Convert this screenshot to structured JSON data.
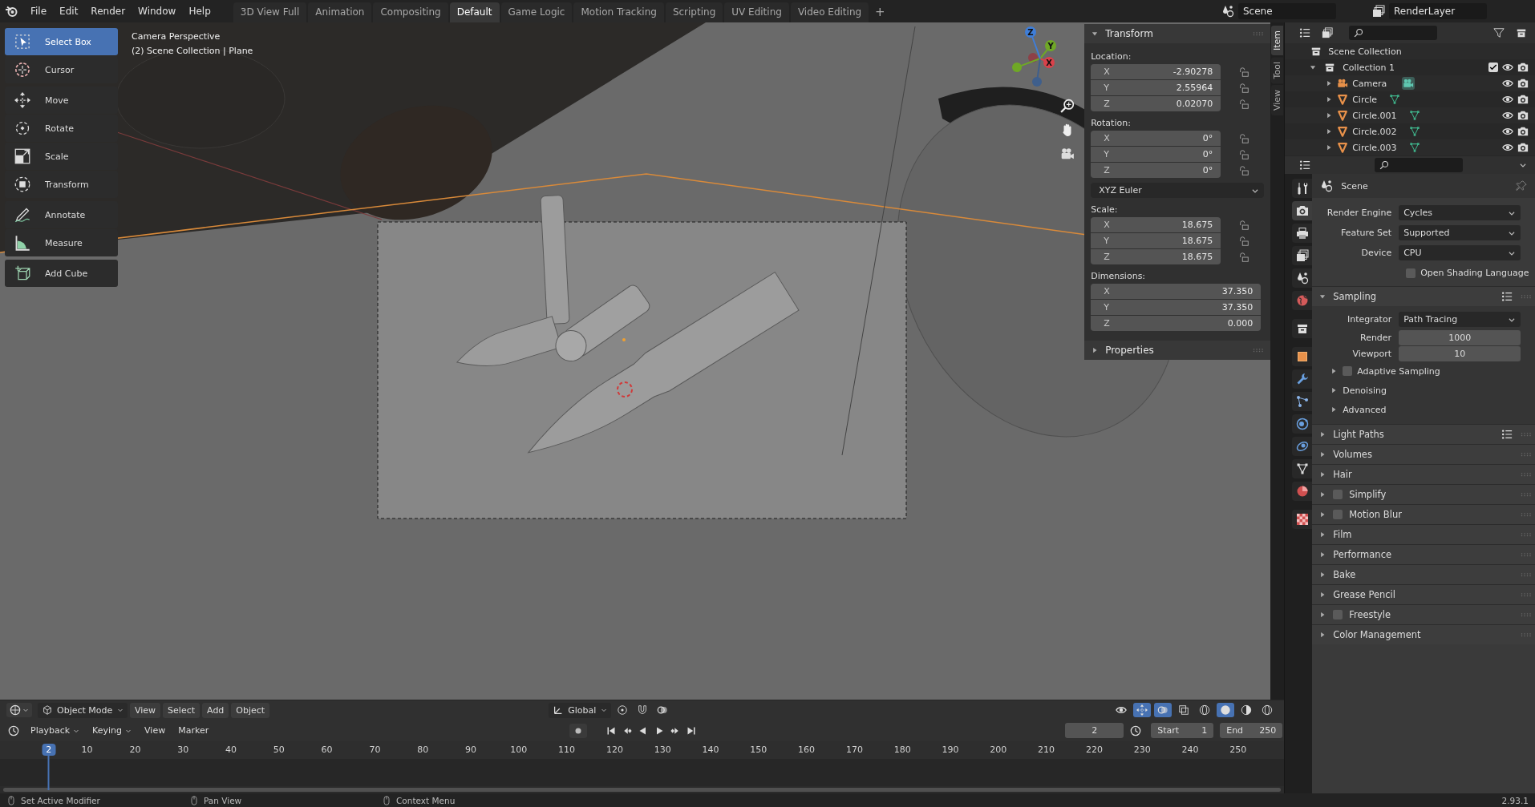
{
  "top_bar": {
    "menus": [
      "File",
      "Edit",
      "Render",
      "Window",
      "Help"
    ],
    "workspaces": [
      {
        "label": "3D View Full",
        "selected": false
      },
      {
        "label": "Animation",
        "selected": false
      },
      {
        "label": "Compositing",
        "selected": false
      },
      {
        "label": "Default",
        "selected": true
      },
      {
        "label": "Game Logic",
        "selected": false
      },
      {
        "label": "Motion Tracking",
        "selected": false
      },
      {
        "label": "Scripting",
        "selected": false
      },
      {
        "label": "UV Editing",
        "selected": false
      },
      {
        "label": "Video Editing",
        "selected": false
      }
    ],
    "add_tab": "+",
    "scene": "Scene",
    "view_layer": "RenderLayer"
  },
  "toolbar": [
    {
      "tools": [
        {
          "label": "Select Box",
          "selected": true
        },
        {
          "label": "Cursor",
          "selected": false
        }
      ]
    },
    {
      "tools": [
        {
          "label": "Move",
          "selected": false
        },
        {
          "label": "Rotate",
          "selected": false
        },
        {
          "label": "Scale",
          "selected": false
        },
        {
          "label": "Transform",
          "selected": false
        }
      ]
    },
    {
      "tools": [
        {
          "label": "Annotate",
          "selected": false
        },
        {
          "label": "Measure",
          "selected": false
        }
      ]
    },
    {
      "tools": [
        {
          "label": "Add Cube",
          "selected": false
        }
      ]
    }
  ],
  "viewport": {
    "info": [
      "Camera Perspective",
      "(2) Scene Collection | Plane"
    ],
    "gizmo_axes": [
      "X",
      "Y",
      "Z"
    ]
  },
  "sidebar": {
    "tabs": [
      {
        "label": "Item",
        "selected": true
      },
      {
        "label": "Tool",
        "selected": false
      },
      {
        "label": "View",
        "selected": false
      }
    ],
    "transform": {
      "title": "Transform",
      "expanded": true,
      "groups": [
        {
          "kind": "vector",
          "label": "Location:",
          "lockable": true,
          "fields": [
            {
              "axis": "X",
              "value": "-2.90278"
            },
            {
              "axis": "Y",
              "value": "2.55964"
            },
            {
              "axis": "Z",
              "value": "0.02070"
            }
          ]
        },
        {
          "kind": "vector",
          "label": "Rotation:",
          "lockable": true,
          "fields": [
            {
              "axis": "X",
              "value": "0°"
            },
            {
              "axis": "Y",
              "value": "0°"
            },
            {
              "axis": "Z",
              "value": "0°"
            }
          ]
        },
        {
          "kind": "dropdown",
          "value": "XYZ Euler"
        },
        {
          "kind": "vector",
          "label": "Scale:",
          "lockable": true,
          "fields": [
            {
              "axis": "X",
              "value": "18.675"
            },
            {
              "axis": "Y",
              "value": "18.675"
            },
            {
              "axis": "Z",
              "value": "18.675"
            }
          ]
        },
        {
          "kind": "vector",
          "label": "Dimensions:",
          "lockable": false,
          "fields": [
            {
              "axis": "X",
              "value": "37.350"
            },
            {
              "axis": "Y",
              "value": "37.350"
            },
            {
              "axis": "Z",
              "value": "0.000"
            }
          ]
        }
      ]
    },
    "properties_panel": {
      "title": "Properties",
      "expanded": false
    }
  },
  "viewport_header": {
    "mode": "Object Mode",
    "menus": [
      "View",
      "Select",
      "Add",
      "Object"
    ],
    "orientation": "Global"
  },
  "timeline": {
    "menus": [
      {
        "label": "Playback",
        "dropdown": true
      },
      {
        "label": "Keying",
        "dropdown": true
      },
      {
        "label": "View",
        "dropdown": false
      },
      {
        "label": "Marker",
        "dropdown": false
      }
    ],
    "current_frame": "2",
    "start_label": "Start",
    "start": "1",
    "end_label": "End",
    "end": "250",
    "playhead": "2",
    "ruler": [
      "10",
      "20",
      "30",
      "40",
      "50",
      "60",
      "70",
      "80",
      "90",
      "100",
      "110",
      "120",
      "130",
      "140",
      "150",
      "160",
      "170",
      "180",
      "190",
      "200",
      "210",
      "220",
      "230",
      "240",
      "250"
    ]
  },
  "status_bar": {
    "hints": [
      "Set Active Modifier",
      "Pan View",
      "Context Menu"
    ],
    "version": "2.93.1"
  },
  "outliner": {
    "root": "Scene Collection",
    "items": [
      {
        "name": "Collection 1",
        "kind": "collection",
        "expanded": true,
        "checked": true,
        "children": [
          {
            "name": "Camera",
            "kind": "camera",
            "expanded": false
          },
          {
            "name": "Circle",
            "kind": "mesh",
            "expanded": false
          },
          {
            "name": "Circle.001",
            "kind": "mesh",
            "expanded": false
          },
          {
            "name": "Circle.002",
            "kind": "mesh",
            "expanded": false
          },
          {
            "name": "Circle.003",
            "kind": "mesh",
            "expanded": false
          }
        ]
      }
    ]
  },
  "properties": {
    "tabs": [
      {
        "kind": "tool",
        "selected": false
      },
      {
        "kind": "render",
        "selected": true
      },
      {
        "kind": "output",
        "selected": false
      },
      {
        "kind": "view_layer",
        "selected": false
      },
      {
        "kind": "scene",
        "selected": false
      },
      {
        "kind": "world",
        "selected": false
      },
      {
        "kind": "collection",
        "selected": false
      },
      {
        "kind": "object",
        "selected": false
      },
      {
        "kind": "modifiers",
        "selected": false
      },
      {
        "kind": "particles",
        "selected": false
      },
      {
        "kind": "physics",
        "selected": false
      },
      {
        "kind": "constraints",
        "selected": false
      },
      {
        "kind": "data",
        "selected": false
      },
      {
        "kind": "material",
        "selected": false
      },
      {
        "kind": "texture",
        "selected": false
      }
    ],
    "context": "Scene",
    "rows": [
      {
        "kind": "dropdown",
        "label": "Render Engine",
        "value": "Cycles"
      },
      {
        "kind": "dropdown",
        "label": "Feature Set",
        "value": "Supported"
      },
      {
        "kind": "dropdown",
        "label": "Device",
        "value": "CPU"
      },
      {
        "kind": "checkbox",
        "label": "Open Shading Language",
        "checked": false
      }
    ],
    "panels": [
      {
        "title": "Sampling",
        "kind": "plain",
        "expanded": true,
        "presets": true,
        "rows": [
          {
            "kind": "dropdown",
            "label": "Integrator",
            "value": "Path Tracing"
          },
          {
            "kind": "number",
            "label": "Render",
            "value": "1000"
          },
          {
            "kind": "number",
            "label": "Viewport",
            "value": "10"
          }
        ],
        "subpanels": [
          {
            "title": "Adaptive Sampling",
            "kind": "checkbox",
            "checked": false,
            "expanded": false
          },
          {
            "title": "Denoising",
            "kind": "plain",
            "expanded": false
          },
          {
            "title": "Advanced",
            "kind": "plain",
            "expanded": false
          }
        ]
      },
      {
        "title": "Light Paths",
        "kind": "plain",
        "expanded": false,
        "presets": true
      },
      {
        "title": "Volumes",
        "kind": "plain",
        "expanded": false,
        "presets": false
      },
      {
        "title": "Hair",
        "kind": "plain",
        "expanded": false,
        "presets": false
      },
      {
        "title": "Simplify",
        "kind": "checkbox",
        "checked": false,
        "expanded": false,
        "presets": false
      },
      {
        "title": "Motion Blur",
        "kind": "checkbox",
        "checked": false,
        "expanded": false,
        "presets": false
      },
      {
        "title": "Film",
        "kind": "plain",
        "expanded": false,
        "presets": false
      },
      {
        "title": "Performance",
        "kind": "plain",
        "expanded": false,
        "presets": false
      },
      {
        "title": "Bake",
        "kind": "plain",
        "expanded": false,
        "presets": false
      },
      {
        "title": "Grease Pencil",
        "kind": "plain",
        "expanded": false,
        "presets": false
      },
      {
        "title": "Freestyle",
        "kind": "checkbox",
        "checked": false,
        "expanded": false,
        "presets": false
      },
      {
        "title": "Color Management",
        "kind": "plain",
        "expanded": false,
        "presets": false
      }
    ]
  }
}
